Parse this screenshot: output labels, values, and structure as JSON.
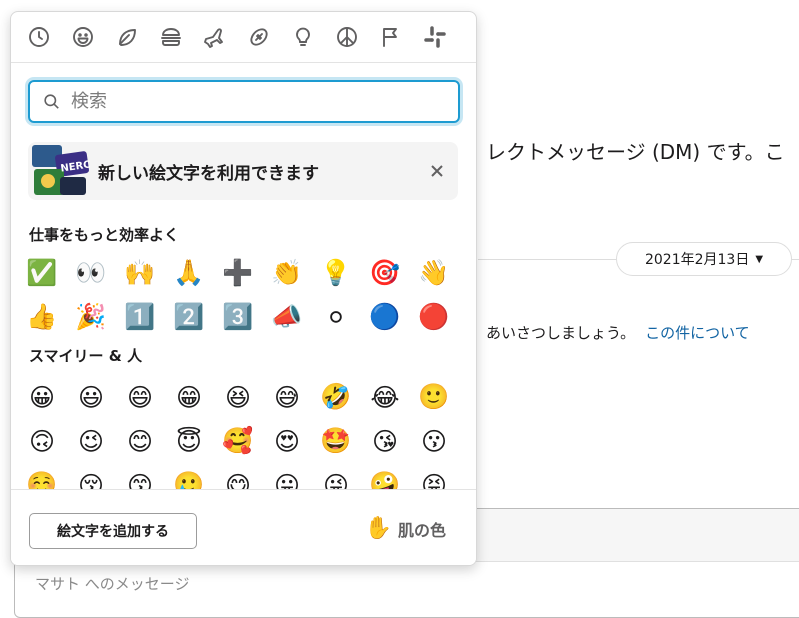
{
  "background": {
    "intro_text": "レクトメッセージ (DM) です。こ",
    "date_pill": "2021年2月13日",
    "message_text": "あいさつしましょう。",
    "message_link": "この件について",
    "composer_placeholder": "マサト へのメッセージ"
  },
  "picker": {
    "categories": [
      "clock-icon",
      "smiley-icon",
      "leaf-icon",
      "burger-icon",
      "plane-icon",
      "football-icon",
      "bulb-icon",
      "peace-icon",
      "flag-icon",
      "slack-icon"
    ],
    "search": {
      "placeholder": "検索",
      "value": ""
    },
    "banner": {
      "text": "新しい絵文字を利用できます",
      "image_text": "NERC"
    },
    "sections": [
      {
        "title": "仕事をもっと効率よく",
        "emojis": [
          "✅",
          "👀",
          "🙌",
          "🙏",
          "➕",
          "👏",
          "💡",
          "🎯",
          "👋",
          "👍",
          "🎉",
          "1️⃣",
          "2️⃣",
          "3️⃣",
          "📣",
          "⚪",
          "🔵",
          "🔴"
        ]
      },
      {
        "title": "スマイリー & 人",
        "emojis": [
          "😀",
          "😃",
          "😄",
          "😁",
          "😆",
          "😅",
          "🤣",
          "😂",
          "🙂",
          "🙃",
          "😉",
          "😊",
          "😇",
          "🥰",
          "😍",
          "🤩",
          "😘",
          "😗",
          "☺️",
          "😚",
          "😙",
          "🥲",
          "😋",
          "😛",
          "😜",
          "🤪",
          "😝"
        ]
      }
    ],
    "footer": {
      "add_button": "絵文字を追加する",
      "skin_label": "肌の色",
      "skin_icon": "✋"
    }
  }
}
